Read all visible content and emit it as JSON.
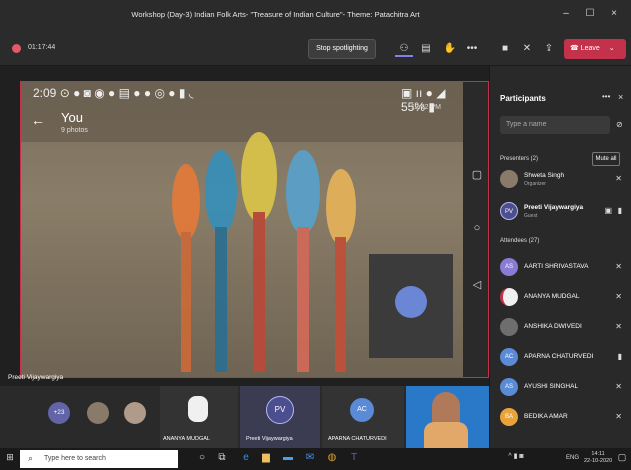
{
  "window": {
    "title": "Workshop (Day-3) Indian Folk Arts- \"Treasure of Indian Culture\"- Theme: Patachitra Art",
    "minimize": "–",
    "maximize": "☐",
    "close": "×"
  },
  "toolbar": {
    "timer": "01:17:44",
    "stop_spotlighting": "Stop spotlighting",
    "leave": "Leave",
    "icons": [
      "participants-icon",
      "chat-icon",
      "raise-hand-icon",
      "more-icon",
      "camera-icon",
      "mic-off-icon",
      "share-icon"
    ]
  },
  "shared_screen": {
    "status_left": "2:09 ⊙ ● ◙ ◉ ● ▤ ● ● ◎ ● ▮ ◟",
    "status_right": "▣ ıı ● ◢ 55% ▮",
    "timestamp": "12:22 PM",
    "album_title": "You",
    "album_subtitle": "9 photos",
    "presenter_name": "Preeti Vijaywargiya"
  },
  "gallery": {
    "overflow_count": "+23",
    "tiles": [
      {
        "name": "ANANYA MUDGAL"
      },
      {
        "name": "Preeti Vijaywargiya",
        "initials": "PV"
      },
      {
        "name": "APARNA CHATURVEDI",
        "initials": "AC"
      }
    ]
  },
  "participants": {
    "title": "Participants",
    "search_placeholder": "Type a name",
    "presenters_label": "Presenters (2)",
    "mute_all": "Mute all",
    "attendees_label": "Attendees (27)",
    "presenters": [
      {
        "name": "Shweta Singh",
        "role": "Organizer"
      },
      {
        "name": "Preeti Vijaywargiya",
        "role": "Guest",
        "initials": "PV"
      }
    ],
    "attendees": [
      {
        "name": "AARTI SHRIVASTAVA",
        "initials": "AS",
        "color": "#8a7bd4"
      },
      {
        "name": "ANANYA MUDGAL",
        "initials": "",
        "color": "#c4314b"
      },
      {
        "name": "ANSHIKA DWIVEDI",
        "initials": "",
        "color": "#6e6e6e"
      },
      {
        "name": "APARNA CHATURVEDI",
        "initials": "AC",
        "color": "#5b8ad6"
      },
      {
        "name": "AYUSHI SINGHAL",
        "initials": "AS",
        "color": "#5b8ad6"
      },
      {
        "name": "BEDIKA AMAR",
        "initials": "BA",
        "color": "#e8a33b"
      }
    ]
  },
  "taskbar": {
    "search_placeholder": "Type here to search",
    "lang": "ENG",
    "time": "14:11",
    "date": "22-10-2020"
  }
}
